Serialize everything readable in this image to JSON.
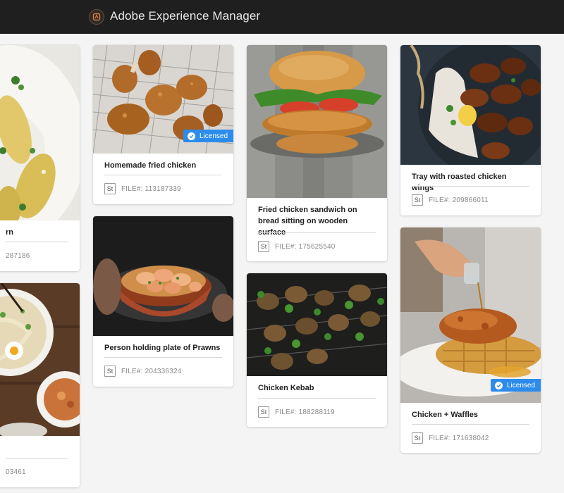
{
  "app": {
    "title": "Adobe Experience Manager"
  },
  "badge_label": "Licensed",
  "stock_icon_label": "St",
  "colors": {
    "topbar": "#1f1f1f",
    "badge": "#2d8ceb",
    "background": "#f4f4f4"
  },
  "cards": [
    {
      "title_fragment": "rn",
      "file_fragment": "287186"
    },
    {
      "file_fragment": "03461"
    },
    {
      "title": "Homemade fried chicken",
      "file": "FILE#: 113187339",
      "licensed": true
    },
    {
      "title": "Person holding plate of Prawns",
      "file": "FILE#: 204336324"
    },
    {
      "title": "Fried chicken sandwich on bread sitting on wooden surface",
      "file": "FILE#: 175625540"
    },
    {
      "title": "Chicken Kebab",
      "file": "FILE#: 188288119"
    },
    {
      "title": "Tray with roasted chicken wings",
      "file": "FILE#: 209866011"
    },
    {
      "title": "Chicken + Waffles",
      "file": "FILE#: 171638042",
      "licensed": true
    }
  ]
}
